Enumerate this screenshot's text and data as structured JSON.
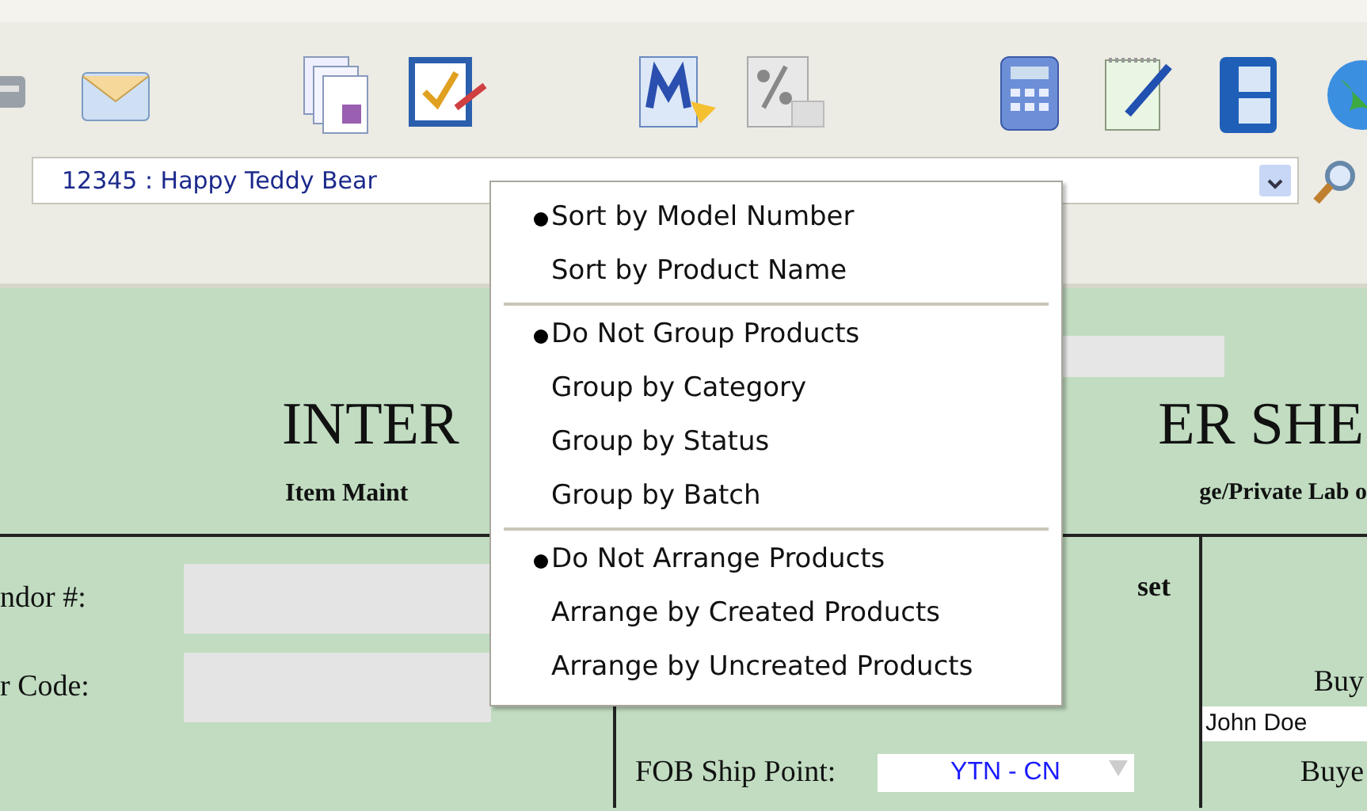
{
  "product_select": {
    "value": "12345 : Happy Teddy Bear"
  },
  "menu": {
    "groups": [
      {
        "items": [
          {
            "label": "Sort by Model Number",
            "selected": true
          },
          {
            "label": "Sort by Product Name",
            "selected": false
          }
        ]
      },
      {
        "items": [
          {
            "label": "Do Not Group Products",
            "selected": true
          },
          {
            "label": "Group by Category",
            "selected": false
          },
          {
            "label": "Group by Status",
            "selected": false
          },
          {
            "label": "Group by Batch",
            "selected": false
          }
        ]
      },
      {
        "items": [
          {
            "label": "Do Not Arrange Products",
            "selected": true
          },
          {
            "label": "Arrange by Created Products",
            "selected": false
          },
          {
            "label": "Arrange by Uncreated Products",
            "selected": false
          }
        ]
      }
    ]
  },
  "form": {
    "title_parts": [
      "INTER",
      "ER SHE"
    ],
    "subtitle_parts": [
      "Item Maint",
      "ge/Private Lab o"
    ],
    "fields": [
      {
        "label": "ndor #:"
      },
      {
        "label": "r Code:"
      }
    ],
    "section_label": "set",
    "fob": {
      "label": "FOB Ship Point:",
      "value": "YTN - CN"
    },
    "buyer": {
      "label": "Buy",
      "value": "John Doe"
    },
    "buyer_2_label": "Buye"
  }
}
